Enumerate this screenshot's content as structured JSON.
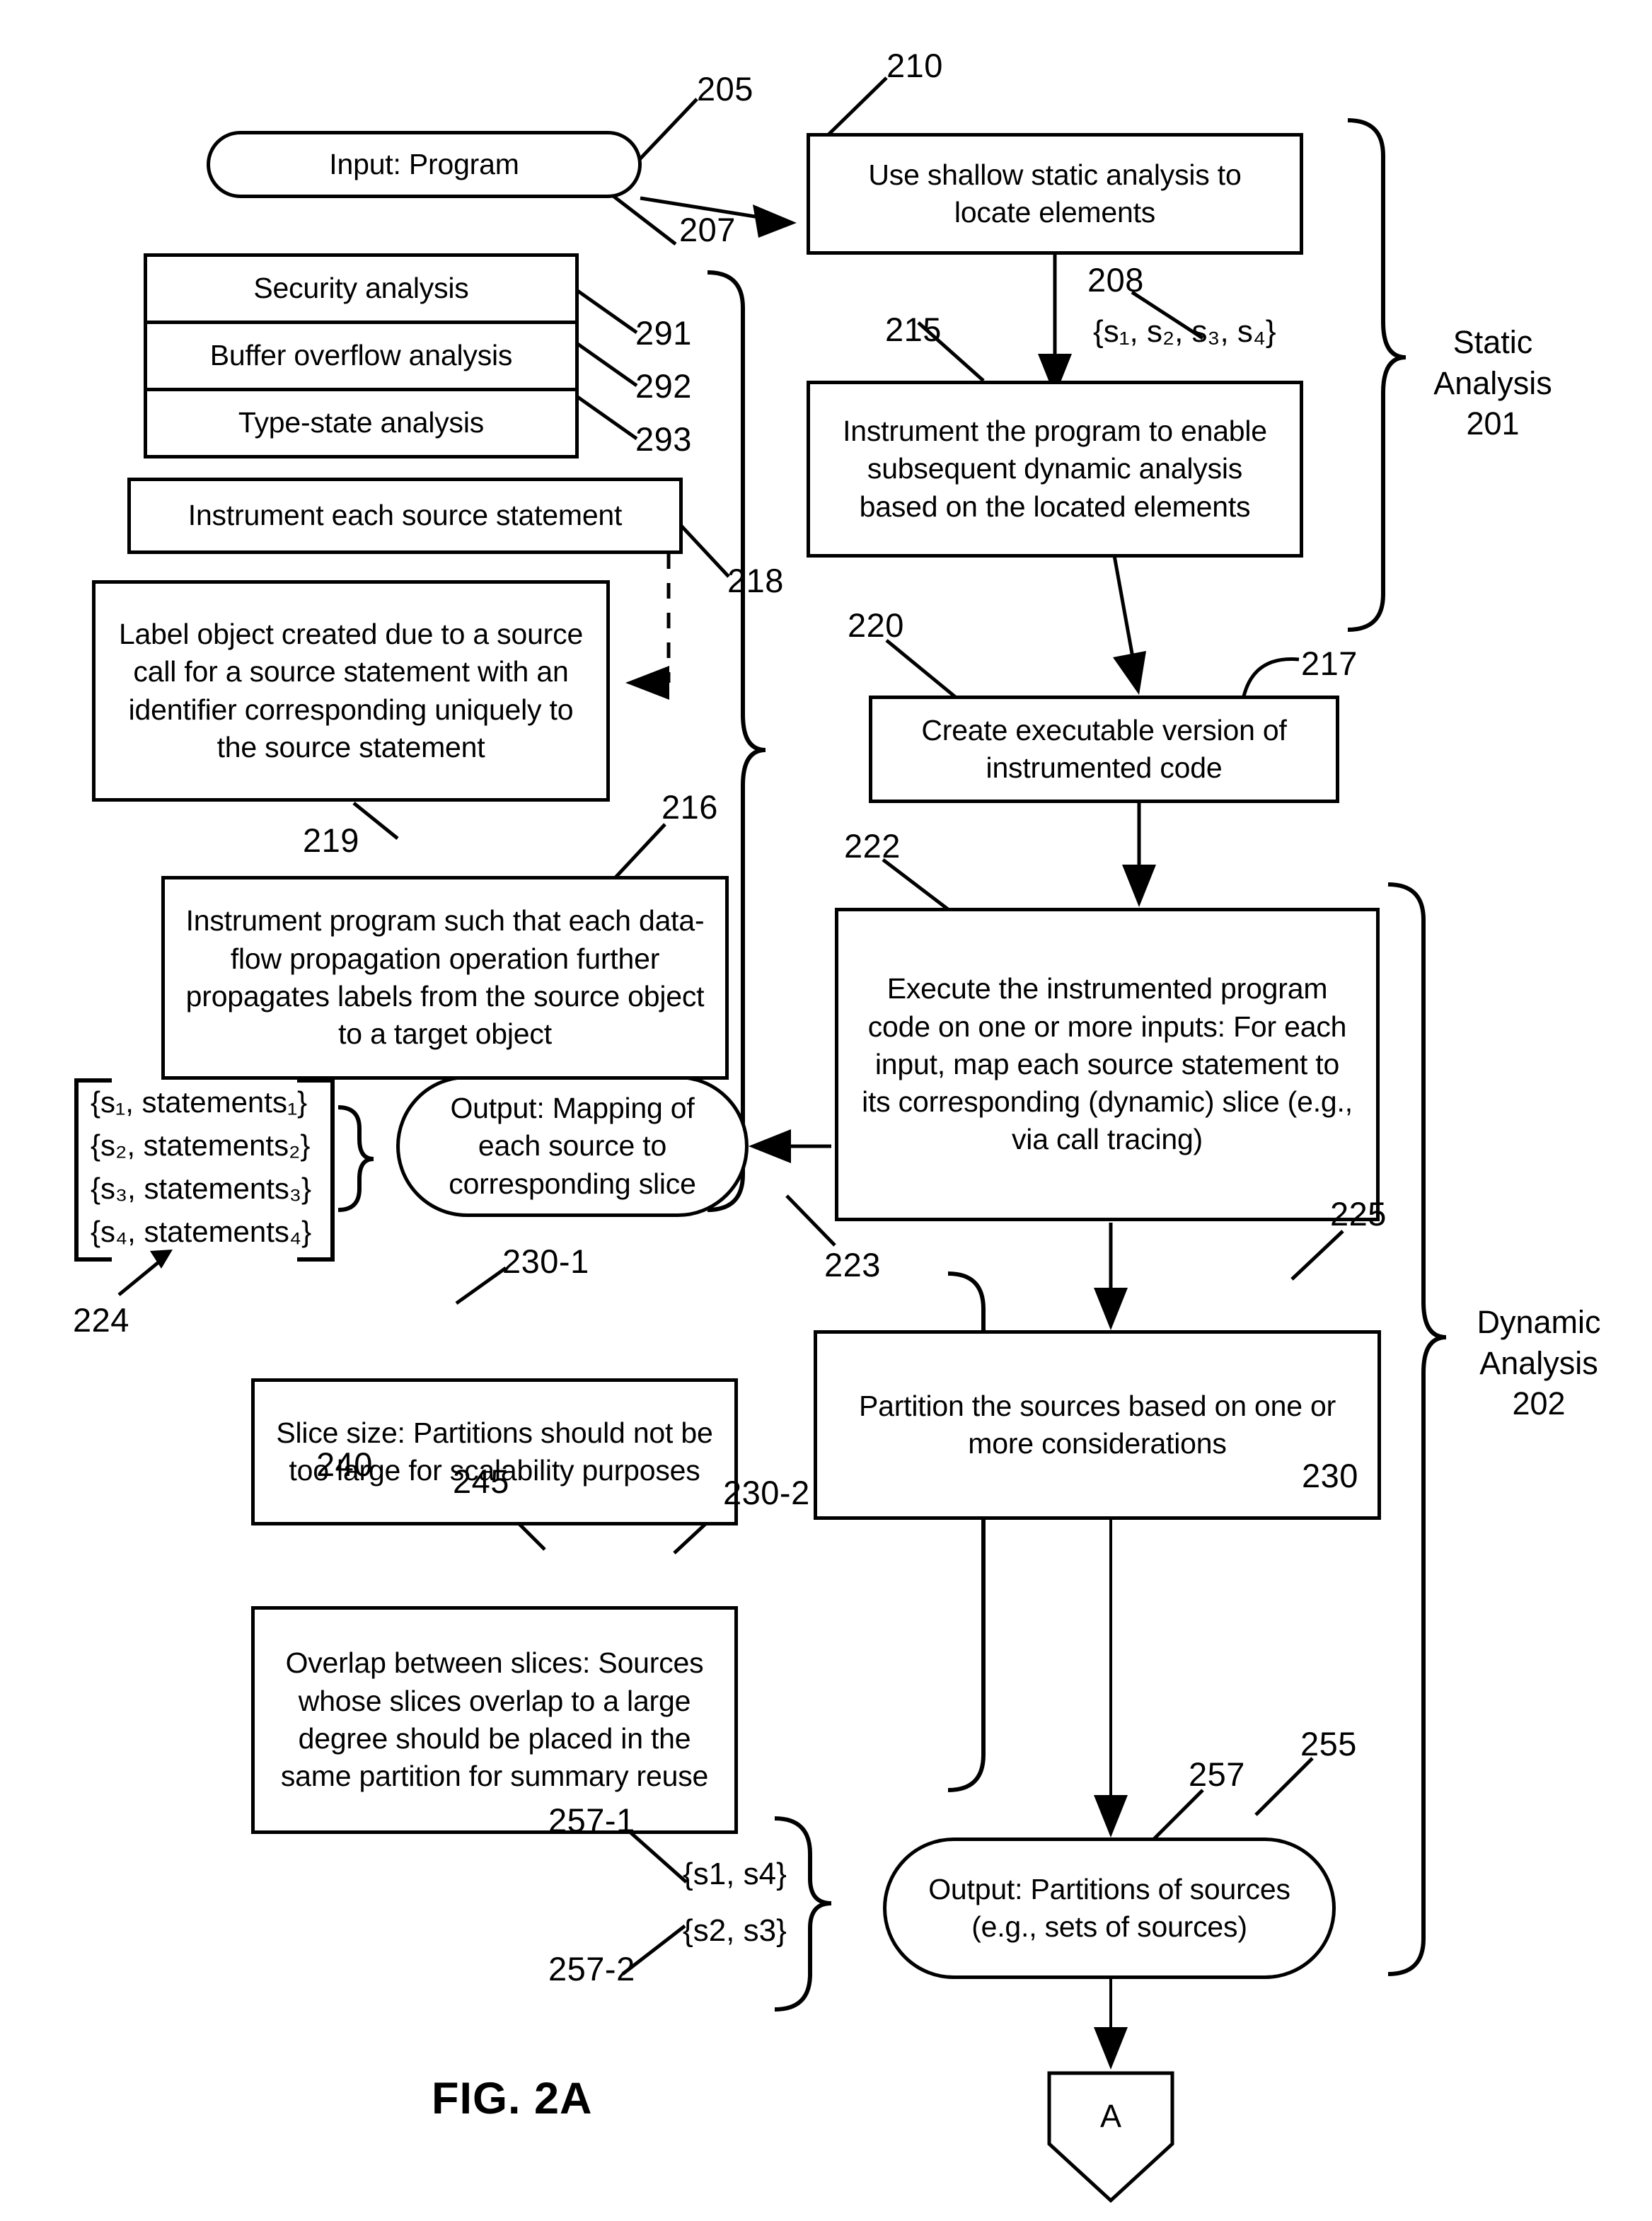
{
  "figure": {
    "caption": "FIG. 2A"
  },
  "nodes": {
    "input_program": "Input: Program",
    "shallow_static": "Use shallow static analysis to locate elements",
    "instrument_program": "Instrument the program to enable subsequent dynamic analysis based on the located elements",
    "create_executable": "Create executable version of instrumented code",
    "execute_instrumented": "Execute the instrumented program code on one or more inputs:  For each input, map each source statement to its corresponding (dynamic) slice (e.g., via call tracing)",
    "partition_sources": "Partition the sources based on one or more considerations",
    "output_partitions": "Output: Partitions of sources (e.g., sets of sources)",
    "output_mapping": "Output: Mapping of each source to corresponding slice",
    "instrument_each_source": "Instrument each source statement",
    "label_object": "Label object created due to a source call for a source statement with an identifier corresponding uniquely to the source statement",
    "instrument_dataflow": "Instrument program such that each data-flow propagation operation further propagates labels from the source object to a target object",
    "slice_size": "Slice size:  Partitions should not be too large for scalability purposes",
    "overlap_slices": "Overlap between slices: Sources whose slices overlap to a large degree should be placed in the same partition for summary reuse",
    "connector_a": "A"
  },
  "analysis_types": {
    "security": "Security analysis",
    "buffer": "Buffer overflow analysis",
    "typestate": "Type-state analysis"
  },
  "sets": {
    "sources_208": "{s₁, s₂, s₃, s₄}",
    "mapping_224": "{s₁, statements₁}\n{s₂, statements₂}\n{s₃, statements₃}\n{s₄, statements₄}",
    "partition_257_1": "{s1, s4}",
    "partition_257_2": "{s2, s3}"
  },
  "groups": {
    "static": "Static\nAnalysis\n201",
    "dynamic": "Dynamic\nAnalysis\n202"
  },
  "refs": {
    "r205": "205",
    "r207": "207",
    "r208": "208",
    "r210": "210",
    "r215": "215",
    "r216": "216",
    "r217": "217",
    "r218": "218",
    "r219": "219",
    "r220": "220",
    "r222": "222",
    "r223": "223",
    "r224": "224",
    "r225": "225",
    "r230": "230",
    "r230_1": "230-1",
    "r230_2": "230-2",
    "r240": "240",
    "r245": "245",
    "r255": "255",
    "r257": "257",
    "r257_1": "257-1",
    "r257_2": "257-2",
    "r291": "291",
    "r292": "292",
    "r293": "293"
  }
}
